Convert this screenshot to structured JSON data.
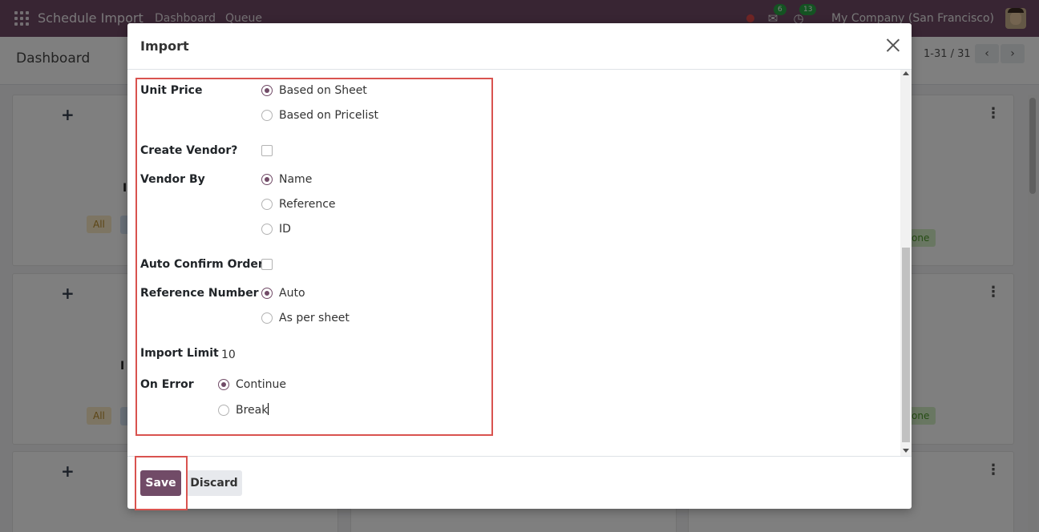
{
  "navbar": {
    "app_title": "Schedule Import",
    "links": [
      "Dashboard",
      "Queue"
    ],
    "messages_count": "6",
    "activities_count": "13",
    "company": "My Company (San Francisco)"
  },
  "control_panel": {
    "title": "Dashboard",
    "pager": "1-31 / 31"
  },
  "background_cards": {
    "tag_all": "All",
    "tag_done": "one",
    "fragment": "I"
  },
  "modal": {
    "title": "Import",
    "fields": {
      "unit_price": {
        "label": "Unit Price",
        "options": [
          "Based on Sheet",
          "Based on Pricelist"
        ],
        "selected": "Based on Sheet"
      },
      "create_vendor": {
        "label": "Create Vendor?",
        "checked": false
      },
      "vendor_by": {
        "label": "Vendor By",
        "options": [
          "Name",
          "Reference",
          "ID"
        ],
        "selected": "Name"
      },
      "auto_confirm": {
        "label": "Auto Confirm Order?",
        "checked": false
      },
      "reference_number": {
        "label": "Reference Number",
        "options": [
          "Auto",
          "As per sheet"
        ],
        "selected": "Auto"
      },
      "import_limit": {
        "label": "Import Limit",
        "value": "10"
      },
      "on_error": {
        "label": "On Error",
        "options": [
          "Continue",
          "Break"
        ],
        "selected": "Continue"
      }
    },
    "footer": {
      "save_label": "Save",
      "discard_label": "Discard"
    }
  },
  "colors": {
    "brand": "#714b67",
    "highlight": "#d9534f"
  }
}
